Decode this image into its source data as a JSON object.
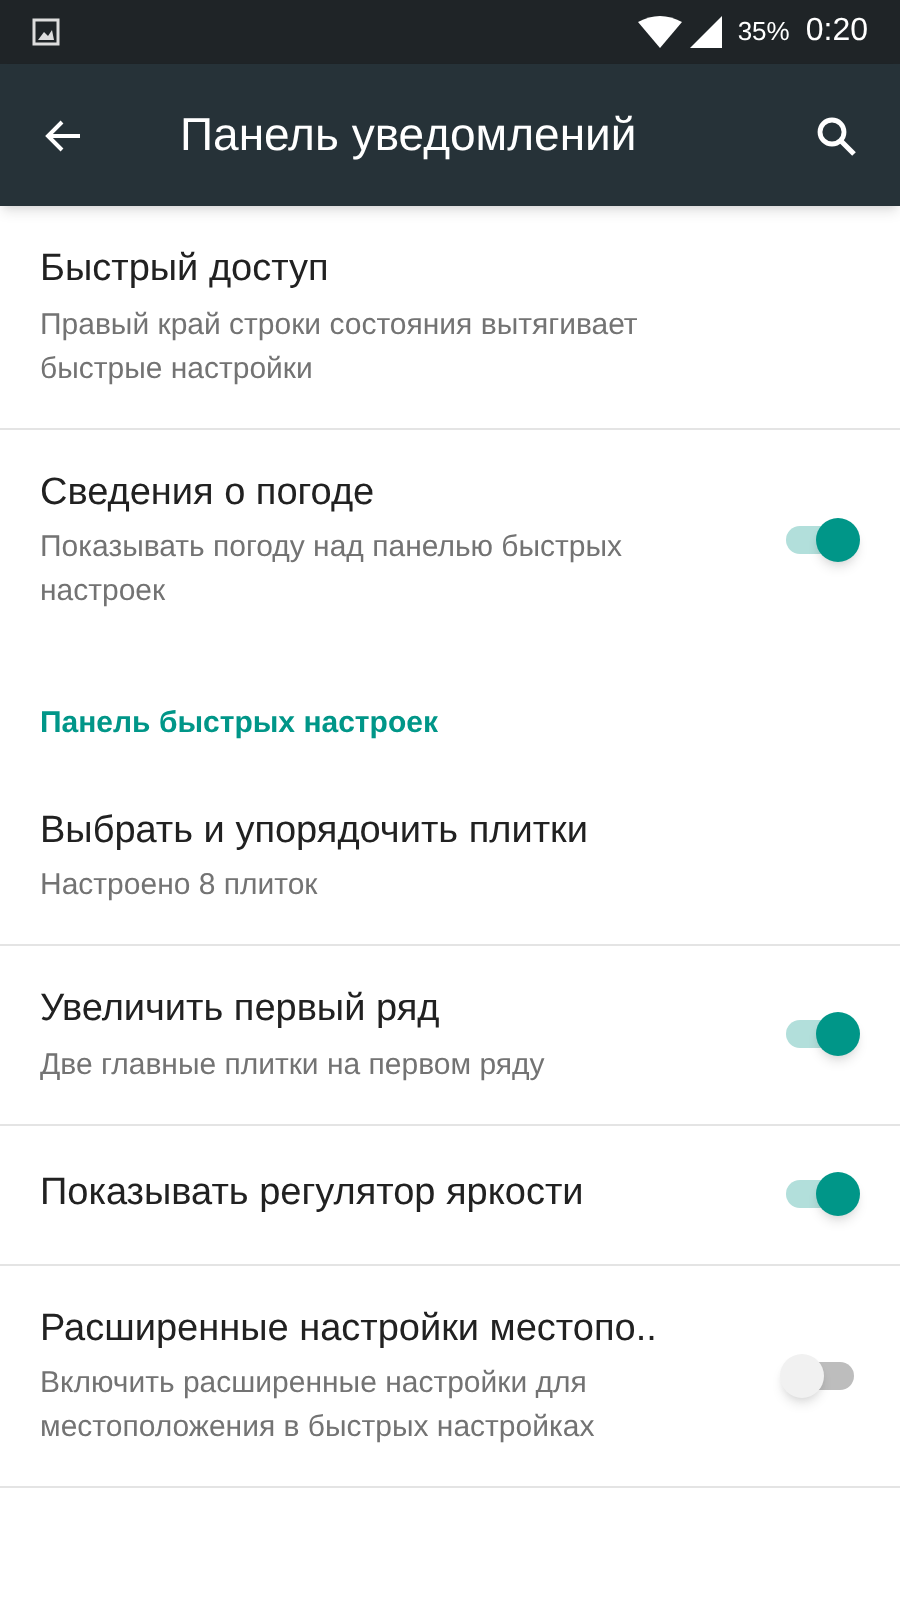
{
  "status_bar": {
    "battery": "35%",
    "time": "0:20"
  },
  "toolbar": {
    "title": "Панель уведомлений"
  },
  "items": [
    {
      "kind": "item",
      "title": "Быстрый доступ",
      "summary": "Правый край строки состояния вытягивает быстрые настройки"
    },
    {
      "kind": "toggle",
      "title": "Сведения о погоде",
      "summary": "Показывать погоду над панелью быстрых настроек",
      "on": true
    },
    {
      "kind": "header",
      "title": "Панель быстрых настроек"
    },
    {
      "kind": "item",
      "title": "Выбрать и упорядочить плитки",
      "summary": "Настроено 8 плиток"
    },
    {
      "kind": "toggle",
      "title": "Увеличить первый ряд",
      "summary": "Две главные плитки на первом ряду",
      "on": true
    },
    {
      "kind": "toggle",
      "title": "Показывать регулятор яркости",
      "on": true
    },
    {
      "kind": "toggle",
      "title": "Расширенные настройки местопо..",
      "summary": "Включить расширенные настройки для местоположения в быстрых настройках",
      "on": false
    }
  ]
}
